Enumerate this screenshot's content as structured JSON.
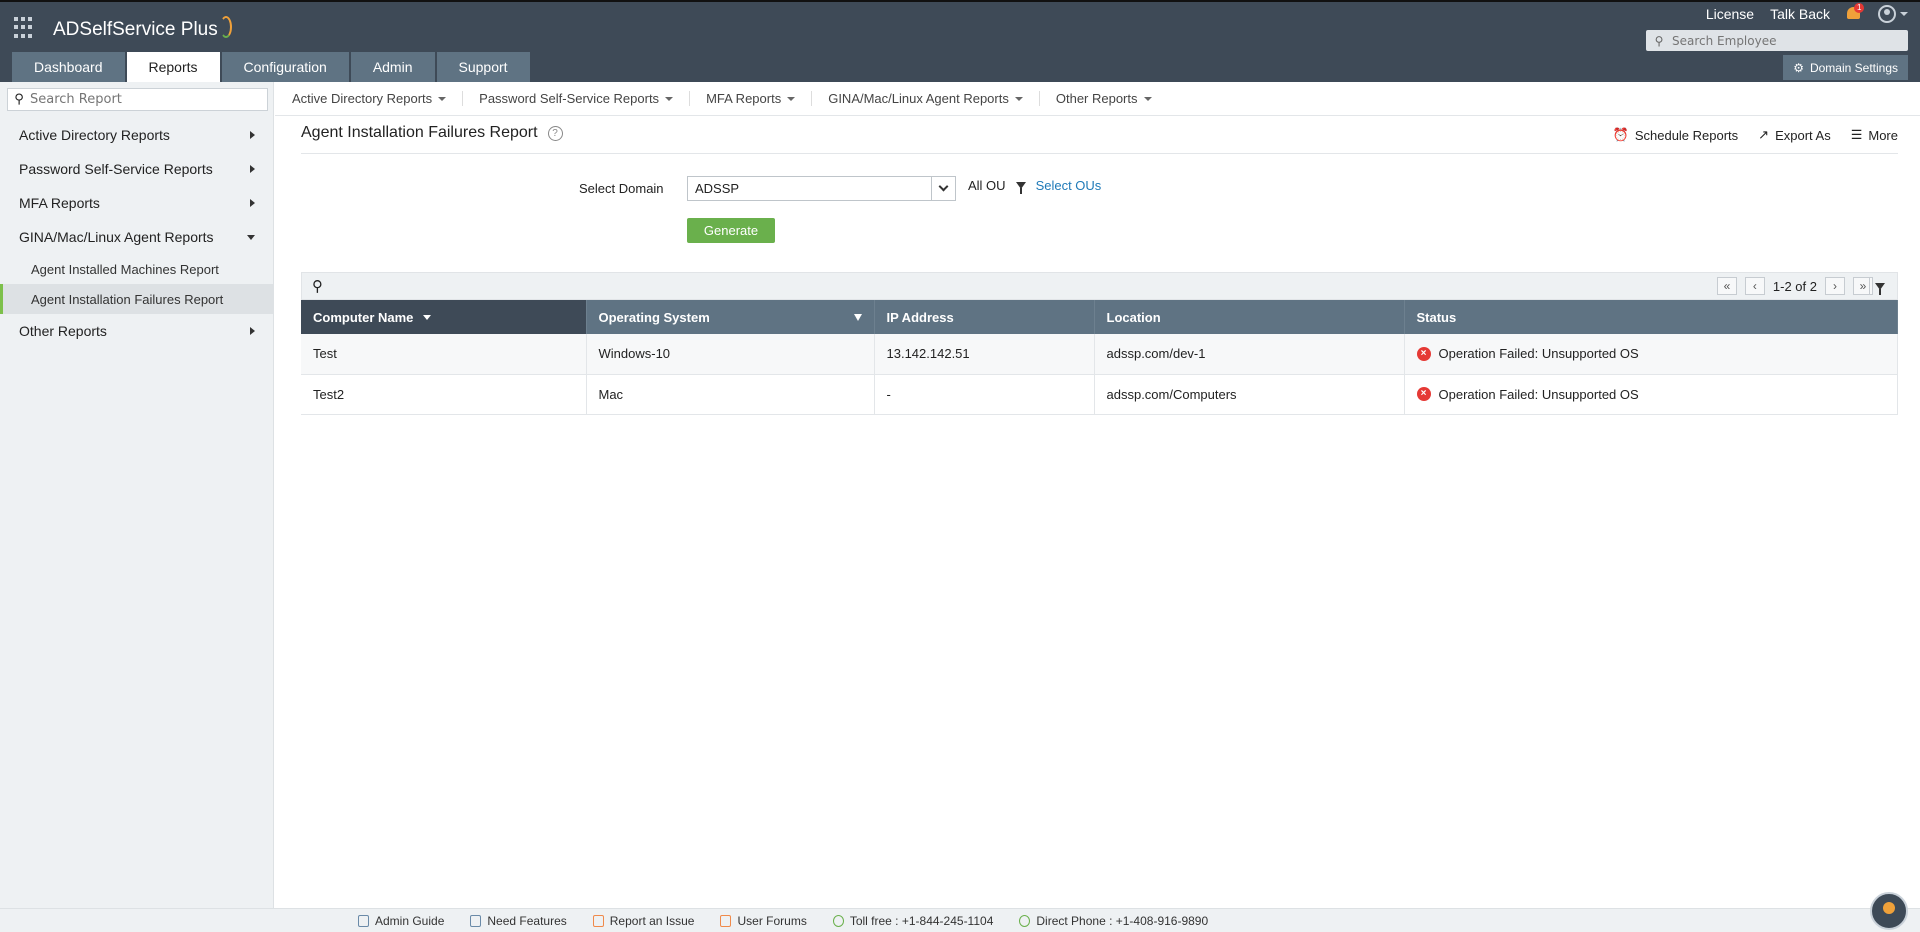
{
  "app": {
    "brand": "ADSelfService Plus",
    "top_links": [
      "License",
      "Talk Back"
    ],
    "notification_count": "1",
    "employee_search_placeholder": "Search Employee",
    "tabs": [
      {
        "label": "Dashboard"
      },
      {
        "label": "Reports"
      },
      {
        "label": "Configuration"
      },
      {
        "label": "Admin"
      },
      {
        "label": "Support"
      }
    ],
    "domain_settings": "Domain Settings"
  },
  "sidebar": {
    "search_placeholder": "Search Report",
    "items": [
      {
        "label": "Active Directory Reports"
      },
      {
        "label": "Password Self-Service Reports"
      },
      {
        "label": "MFA Reports"
      },
      {
        "label": "GINA/Mac/Linux Agent Reports"
      },
      {
        "label": "Other Reports"
      }
    ],
    "sub_items": [
      {
        "label": "Agent Installed Machines Report"
      },
      {
        "label": "Agent Installation Failures Report"
      }
    ]
  },
  "subnav": [
    {
      "label": "Active Directory Reports"
    },
    {
      "label": "Password Self-Service Reports"
    },
    {
      "label": "MFA Reports"
    },
    {
      "label": "GINA/Mac/Linux Agent Reports"
    },
    {
      "label": "Other Reports"
    }
  ],
  "report": {
    "title": "Agent Installation Failures Report",
    "actions": [
      "Schedule Reports",
      "Export As",
      "More"
    ],
    "select_domain_label": "Select Domain",
    "domain_value": "ADSSP",
    "ou_label": "All OU",
    "select_ous": "Select OUs",
    "generate": "Generate"
  },
  "table": {
    "pager": "1-2 of 2",
    "columns": [
      "Computer Name",
      "Operating System",
      "IP Address",
      "Location",
      "Status"
    ],
    "rows": [
      {
        "computer": "Test",
        "os": "Windows-10",
        "ip": "13.142.142.51",
        "location": "adssp.com/dev-1",
        "status": "Operation Failed: Unsupported OS"
      },
      {
        "computer": "Test2",
        "os": "Mac",
        "ip": "-",
        "location": "adssp.com/Computers",
        "status": "Operation Failed: Unsupported OS"
      }
    ]
  },
  "footer": [
    {
      "label": "Admin Guide"
    },
    {
      "label": "Need Features"
    },
    {
      "label": "Report an Issue"
    },
    {
      "label": "User Forums"
    },
    {
      "label": "Toll free : +1-844-245-1104"
    },
    {
      "label": "Direct Phone : +1-408-916-9890"
    }
  ],
  "colors": {
    "header": "#3e4a57",
    "tab": "#5f7383",
    "accent_green": "#6ab04c",
    "link": "#1f7ab8",
    "error": "#e53935"
  }
}
